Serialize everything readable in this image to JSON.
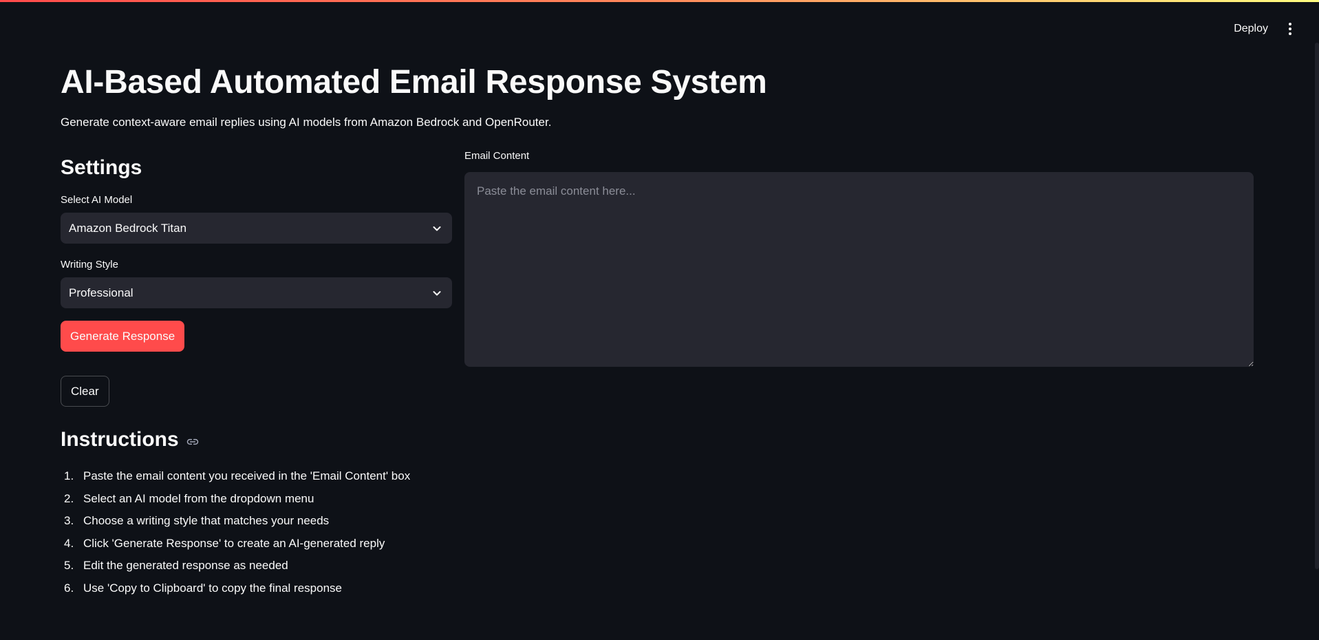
{
  "header": {
    "deploy_label": "Deploy",
    "menu_icon": "kebab-menu-icon"
  },
  "page": {
    "title": "AI-Based Automated Email Response System",
    "subtitle": "Generate context-aware email replies using AI models from Amazon Bedrock and OpenRouter."
  },
  "settings": {
    "title": "Settings",
    "model_label": "Select AI Model",
    "model_value": "Amazon Bedrock Titan",
    "style_label": "Writing Style",
    "style_value": "Professional",
    "generate_label": "Generate Response",
    "clear_label": "Clear"
  },
  "email": {
    "label": "Email Content",
    "placeholder": "Paste the email content here...",
    "value": ""
  },
  "instructions": {
    "title": "Instructions",
    "items": [
      {
        "num": "1.",
        "text": "Paste the email content you received in the 'Email Content' box"
      },
      {
        "num": "2.",
        "text": "Select an AI model from the dropdown menu"
      },
      {
        "num": "3.",
        "text": "Choose a writing style that matches your needs"
      },
      {
        "num": "4.",
        "text": "Click 'Generate Response' to create an AI-generated reply"
      },
      {
        "num": "5.",
        "text": "Edit the generated response as needed"
      },
      {
        "num": "6.",
        "text": "Use 'Copy to Clipboard' to copy the final response"
      }
    ]
  },
  "colors": {
    "background": "#0e1117",
    "primary": "#ff4b4b",
    "input_bg": "#262730",
    "text": "#fafafa"
  }
}
